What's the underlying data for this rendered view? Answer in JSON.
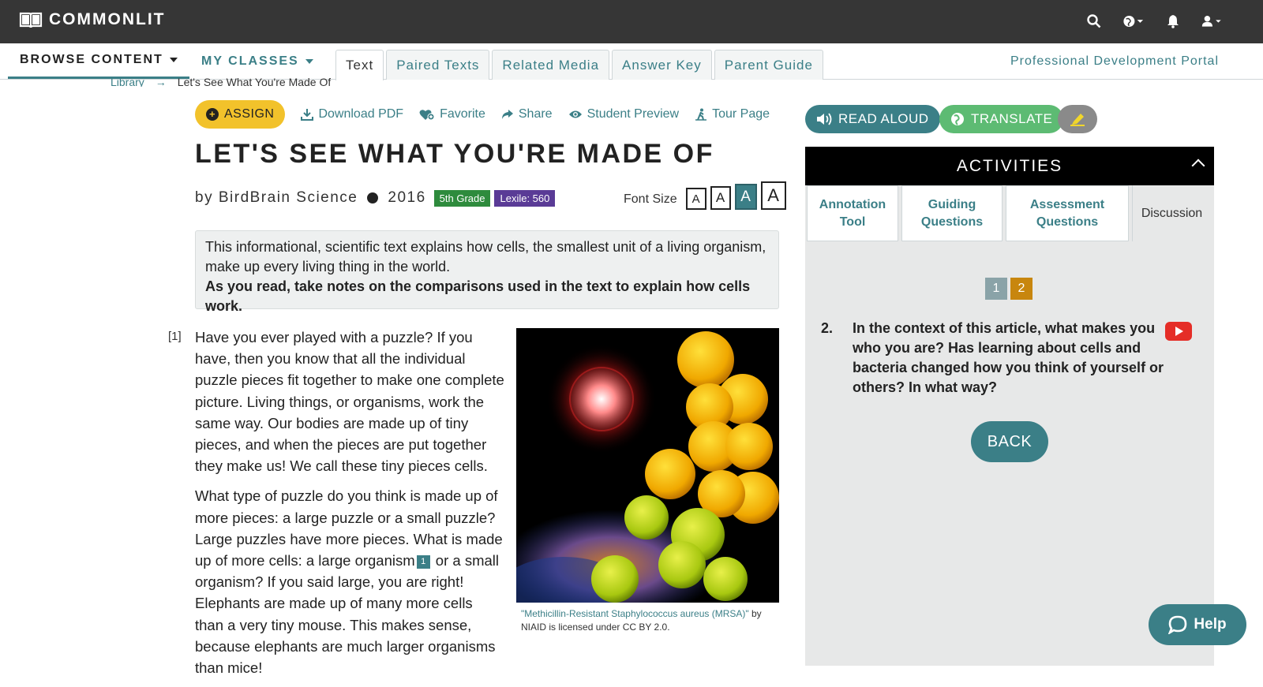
{
  "app": {
    "logo_text": "COMMONLIT"
  },
  "topbar": {
    "icons": [
      "search-icon",
      "globe-icon",
      "bell-icon",
      "user-icon"
    ]
  },
  "nav": {
    "browse": "BROWSE CONTENT",
    "my_classes": "MY CLASSES",
    "tabs": [
      "Text",
      "Paired Texts",
      "Related Media",
      "Answer Key",
      "Parent Guide"
    ],
    "active_tab": "Text",
    "pd_portal": "Professional Development Portal"
  },
  "breadcrumb": {
    "library": "Library",
    "current": "Let's See What You're Made Of"
  },
  "actions": {
    "assign": "ASSIGN",
    "download": "Download PDF",
    "favorite": "Favorite",
    "share": "Share",
    "student_preview": "Student Preview",
    "tour_page": "Tour Page"
  },
  "text": {
    "title": "LET'S SEE WHAT YOU'RE MADE OF",
    "author": "by BirdBrain Science",
    "year": "2016",
    "grade": "5th Grade",
    "lexile": "Lexile: 560",
    "font_size_label": "Font Size",
    "font_size_options": [
      "A",
      "A",
      "A",
      "A"
    ],
    "intro_line": "This informational, scientific text explains how cells, the smallest unit of a living organism, make up every living thing in the world.",
    "intro_bold": "As you read, take notes on the comparisons used in the text to explain how cells work.",
    "para_num": "[1]",
    "para1": "Have you ever played with a puzzle? If you have, then you know that all the individual puzzle pieces fit together to make one complete picture. Living things, or organisms, work the same way. Our bodies are made up of tiny pieces, and when the pieces are put together they make us! We call these tiny pieces cells.",
    "para2_a": "What type of puzzle do you think is made up of more pieces: a large puzzle or a small puzzle? Large puzzles have more pieces. What is made up of more cells: a large organism",
    "footnote": "1",
    "para2_b": "or a small organism? If you said large, you are right! Elephants are made up of many more cells than a very tiny mouse. This makes sense, because elephants are much larger organisms than mice!",
    "caption_link": "\"Methicillin-Resistant Staphylococcus aureus (MRSA)\"",
    "caption_rest": " by NIAID is licensed under CC BY 2.0."
  },
  "tools": {
    "read_aloud": "READ ALOUD",
    "translate": "TRANSLATE"
  },
  "activities": {
    "header": "ACTIVITIES",
    "tabs": [
      "Annotation Tool",
      "Guiding Questions",
      "Assessment Questions",
      "Discussion"
    ],
    "pages": [
      "1",
      "2"
    ],
    "current_page": "2",
    "question_number": "2.",
    "question": "In the context of this article, what makes you who you are? Has learning about cells and bacteria changed how you think of yourself or others? In what way?",
    "back": "BACK"
  },
  "help": {
    "label": "Help"
  },
  "colors": {
    "teal": "#3b7f87",
    "yellow": "#f2c22b",
    "green": "#5dbb73",
    "grade_green": "#2e8b3d",
    "lexile_purple": "#5a3b96",
    "page_orange": "#c8860e",
    "topbar": "#363636"
  }
}
